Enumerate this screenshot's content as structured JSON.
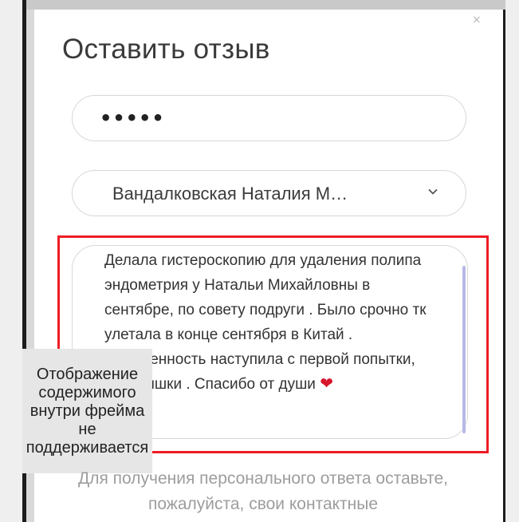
{
  "modal": {
    "title": "Оставить отзыв",
    "close_glyph": "×"
  },
  "password_field": {
    "value": "•••••"
  },
  "doctor_select": {
    "value": "Вандалковская Наталия М…",
    "icon": "chevron-down-icon"
  },
  "review": {
    "text": "Делала гистероскопию для удаления полипа эндометрия у Натальи Михайловны в сентябре, по совету подруги . Было срочно тк улетала в конце сентября в Китай . Беременность наступила с первой попытки, двойняшки . Спасибо от души",
    "emoji": "❤"
  },
  "frame_notice": {
    "text": "Отображение содержимого внутри фрейма не поддерживается"
  },
  "hint": {
    "text": "Для получения персонального ответа оставьте, пожалуйста, свои контактные"
  },
  "colors": {
    "highlight": "#ee1c24",
    "heart": "#d8152b",
    "scrollbar": "#b9b9e6"
  }
}
